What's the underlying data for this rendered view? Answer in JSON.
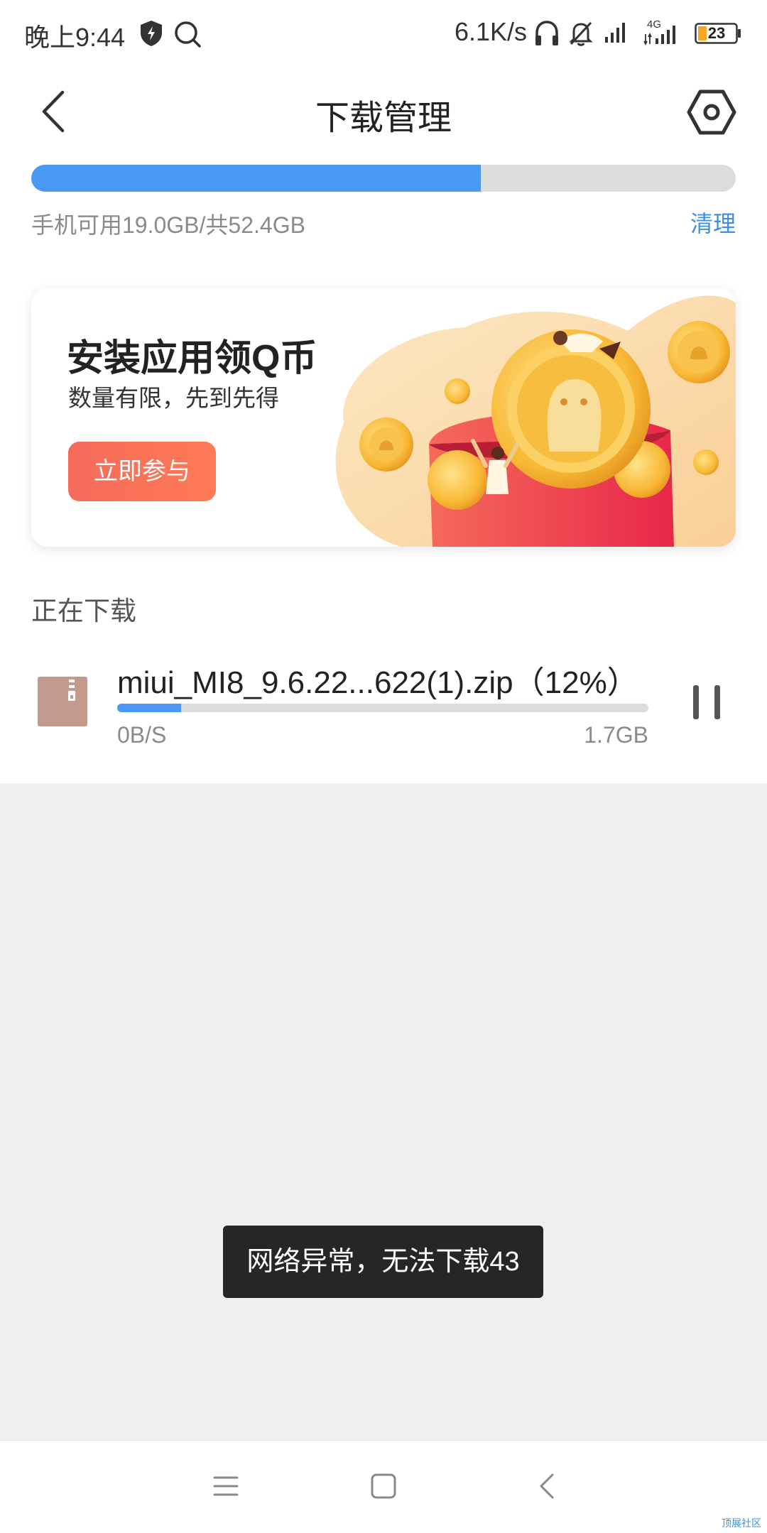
{
  "status_bar": {
    "time": "晚上9:44",
    "network_speed": "6.1K/s",
    "network_type": "4G",
    "battery": "23",
    "icons": [
      "shield-icon",
      "search-icon",
      "headphones-icon",
      "mute-bell-icon",
      "signal-icon",
      "signal-4g-icon",
      "battery-icon"
    ]
  },
  "header": {
    "title": "下载管理",
    "back_icon": "back-icon",
    "settings_icon": "settings-icon"
  },
  "storage": {
    "text": "手机可用19.0GB/共52.4GB",
    "clean_label": "清理",
    "used_fraction": 0.638
  },
  "banner": {
    "title": "安装应用领Q币",
    "subtitle": "数量有限，先到先得",
    "button_label": "立即参与"
  },
  "downloading": {
    "section_label": "正在下载",
    "items": [
      {
        "name": "miui_MI8_9.6.22...622(1).zip（12%）",
        "progress": 0.12,
        "speed": "0B/S",
        "size": "1.7GB",
        "icon": "zip-file-icon",
        "action_icon": "pause-icon"
      }
    ]
  },
  "toast": {
    "message": "网络异常，无法下载43"
  },
  "nav": {
    "icons": [
      "menu-icon",
      "home-icon",
      "nav-back-icon"
    ]
  },
  "watermark": "顶展社区",
  "colors": {
    "accent": "#4a9af5",
    "link": "#3d8fe0",
    "button": "#f56b5b",
    "toast_bg": "#262626"
  }
}
